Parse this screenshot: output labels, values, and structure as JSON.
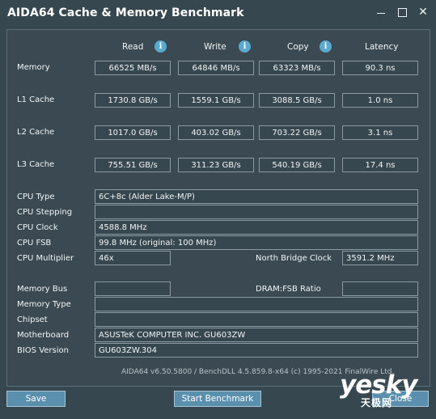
{
  "window": {
    "title": "AIDA64 Cache & Memory Benchmark",
    "close_glyph": "✕"
  },
  "headers": {
    "read": "Read",
    "write": "Write",
    "copy": "Copy",
    "latency": "Latency",
    "info_glyph": "i"
  },
  "rows": {
    "memory": {
      "label": "Memory",
      "read": "66525 MB/s",
      "write": "64846 MB/s",
      "copy": "63323 MB/s",
      "latency": "90.3 ns"
    },
    "l1": {
      "label": "L1 Cache",
      "read": "1730.8 GB/s",
      "write": "1559.1 GB/s",
      "copy": "3088.5 GB/s",
      "latency": "1.0 ns"
    },
    "l2": {
      "label": "L2 Cache",
      "read": "1017.0 GB/s",
      "write": "403.02 GB/s",
      "copy": "703.22 GB/s",
      "latency": "3.1 ns"
    },
    "l3": {
      "label": "L3 Cache",
      "read": "755.51 GB/s",
      "write": "311.23 GB/s",
      "copy": "540.19 GB/s",
      "latency": "17.4 ns"
    }
  },
  "cpu": {
    "type_label": "CPU Type",
    "type_value": "6C+8c   (Alder Lake-M/P)",
    "stepping_label": "CPU Stepping",
    "stepping_value": "",
    "clock_label": "CPU Clock",
    "clock_value": "4588.8 MHz",
    "fsb_label": "CPU FSB",
    "fsb_value": "99.8 MHz  (original: 100 MHz)",
    "multiplier_label": "CPU Multiplier",
    "multiplier_value": "46x",
    "nb_clock_label": "North Bridge Clock",
    "nb_clock_value": "3591.2 MHz"
  },
  "system": {
    "memory_bus_label": "Memory Bus",
    "memory_bus_value": "",
    "dram_fsb_label": "DRAM:FSB Ratio",
    "dram_fsb_value": "",
    "memory_type_label": "Memory Type",
    "memory_type_value": "",
    "chipset_label": "Chipset",
    "chipset_value": "",
    "motherboard_label": "Motherboard",
    "motherboard_value": "ASUSTeK COMPUTER INC. GU603ZW",
    "bios_label": "BIOS Version",
    "bios_value": "GU603ZW.304"
  },
  "footer": "AIDA64 v6.50.5800 / BenchDLL 4.5.859.8-x64  (c) 1995-2021 FinalWire Ltd.",
  "buttons": {
    "save": "Save",
    "start_benchmark": "Start Benchmark",
    "close": "Close"
  },
  "watermark": {
    "brand": "yesky",
    "sub": "天极网"
  },
  "colors": {
    "background": "#37474f",
    "panel": "#3b4a52",
    "button": "#5b8fae",
    "info_icon": "#5aaad0"
  }
}
